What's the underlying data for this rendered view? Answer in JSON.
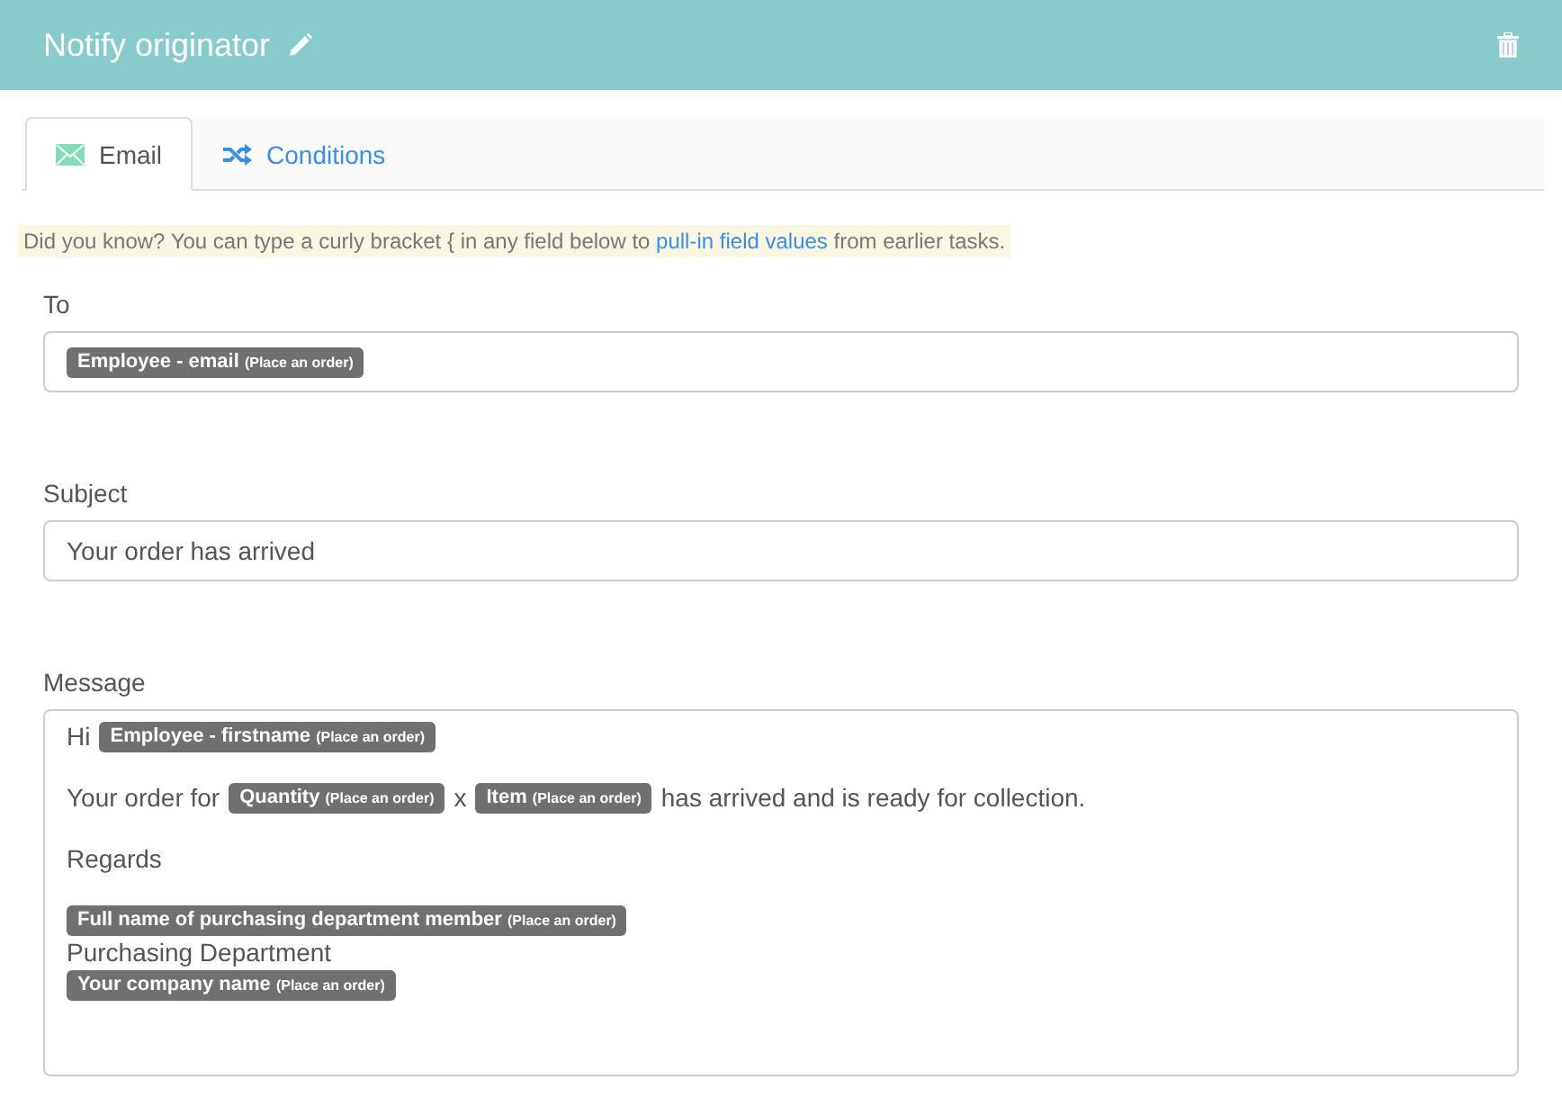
{
  "header": {
    "title": "Notify originator"
  },
  "tabs": [
    {
      "label": "Email",
      "kind": "email",
      "selected": true
    },
    {
      "label": "Conditions",
      "kind": "conditions",
      "selected": false
    }
  ],
  "hint": {
    "before": "Did you know? You can type a curly bracket { in any field below to ",
    "link": "pull-in field values",
    "after": " from earlier tasks."
  },
  "to": {
    "label": "To",
    "tags": [
      {
        "name": "Employee - email",
        "source": "(Place an order)"
      }
    ]
  },
  "subject": {
    "label": "Subject",
    "value": "Your order has arrived"
  },
  "message": {
    "label": "Message",
    "paragraphs": [
      [
        [
          {
            "kind": "text",
            "text": "Hi"
          },
          {
            "kind": "tag",
            "name": "Employee - firstname",
            "source": "(Place an order)"
          }
        ]
      ],
      [
        [
          {
            "kind": "text",
            "text": "Your order for"
          },
          {
            "kind": "tag",
            "name": "Quantity",
            "source": "(Place an order)"
          },
          {
            "kind": "text",
            "text": "x"
          },
          {
            "kind": "tag",
            "name": "Item",
            "source": "(Place an order)"
          },
          {
            "kind": "text",
            "text": "has arrived and is ready for collection."
          }
        ]
      ],
      [
        [
          {
            "kind": "text",
            "text": "Regards"
          }
        ]
      ],
      [
        [
          {
            "kind": "tag",
            "name": "Full name of purchasing department member",
            "source": "(Place an order)"
          }
        ],
        [
          {
            "kind": "text",
            "text": "Purchasing Department"
          }
        ],
        [
          {
            "kind": "tag",
            "name": "Your company name",
            "source": "(Place an order)"
          }
        ]
      ]
    ]
  }
}
